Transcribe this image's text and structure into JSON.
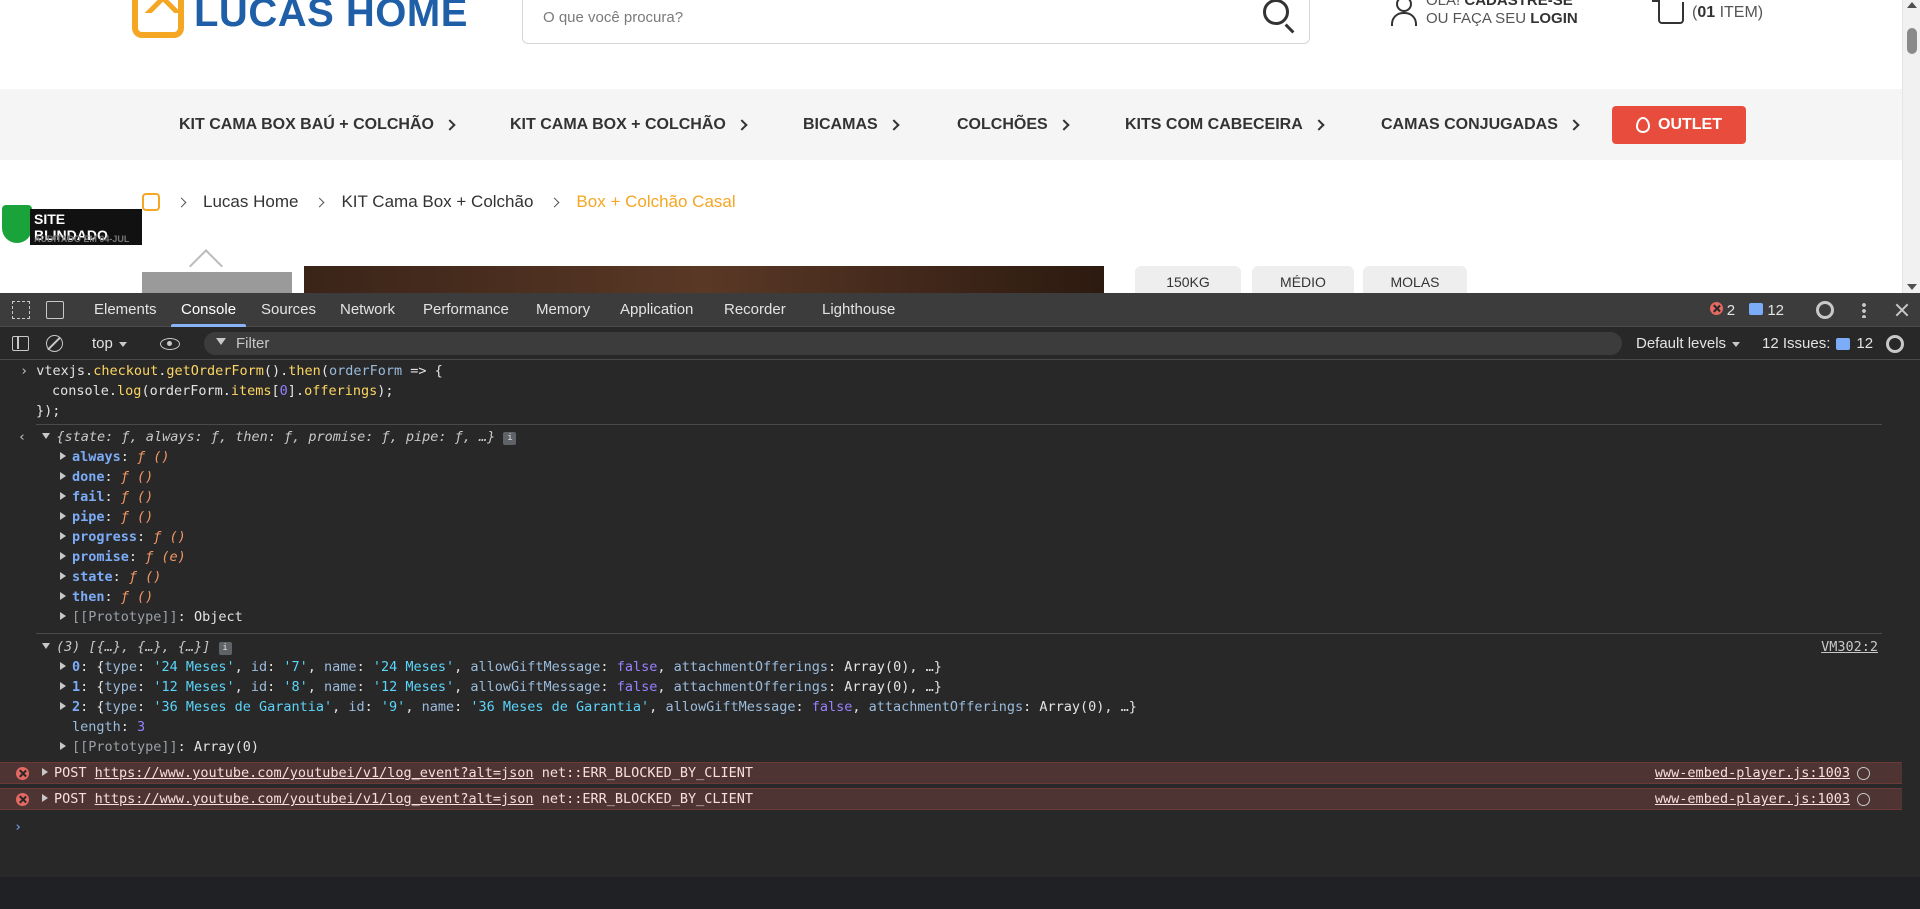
{
  "site": {
    "logo_text": "LUCAS HOME",
    "search_placeholder": "O que você procura?",
    "account_line1_prefix": "OLÁ!",
    "account_line1_bold": "CADASTRE-SE",
    "account_line2_prefix": "OU FAÇA SEU",
    "account_line2_bold": "LOGIN",
    "cart_count": "01",
    "cart_suffix": "ITEM)",
    "cart_prefix": "(",
    "menu": [
      {
        "label": "KIT CAMA BOX BAÚ + COLCHÃO"
      },
      {
        "label": "KIT CAMA BOX + COLCHÃO"
      },
      {
        "label": "BICAMAS"
      },
      {
        "label": "COLCHÕES"
      },
      {
        "label": "KITS COM CABECEIRA"
      },
      {
        "label": "CAMAS CONJUGADAS"
      }
    ],
    "outlet_label": "OUTLET",
    "badge_title": "SITE BLINDADO",
    "badge_sub": "AUDITADO EM 04-JUL",
    "breadcrumb": [
      "Lucas Home",
      "KIT Cama Box + Colchão",
      "Box + Colchão Casal"
    ],
    "chips": [
      "150KG",
      "MÉDIO",
      "MOLAS"
    ],
    "colors": {
      "brand_blue": "#1f5fa8",
      "brand_orange": "#f5a623",
      "outlet_red": "#e74c3c"
    }
  },
  "devtools": {
    "tabs": [
      "Elements",
      "Console",
      "Sources",
      "Network",
      "Performance",
      "Memory",
      "Application",
      "Recorder",
      "Lighthouse"
    ],
    "active_tab": "Console",
    "error_count": "2",
    "message_count": "12",
    "context": "top",
    "filter_placeholder": "Filter",
    "levels": "Default levels",
    "issues_label": "12 Issues:",
    "issues_count": "12"
  },
  "console": {
    "input_line1_obj": "vtexjs",
    "input_line1_a": ".",
    "input_line1_checkout": "checkout",
    "input_line1_get": "getOrderForm",
    "input_line1_then": "then",
    "input_line1_param": "orderForm",
    "input_line2_console": "console",
    "input_line2_log": "log",
    "input_line2_param": "orderForm",
    "input_line2_items": "items",
    "input_line2_idx": "0",
    "input_line2_offerings": "offerings",
    "input_line3": "});",
    "result_summary": "{state: ƒ, always: ƒ, then: ƒ, promise: ƒ, pipe: ƒ, …}",
    "result_props": [
      {
        "key": "always",
        "val": "ƒ ()"
      },
      {
        "key": "done",
        "val": "ƒ ()"
      },
      {
        "key": "fail",
        "val": "ƒ ()"
      },
      {
        "key": "pipe",
        "val": "ƒ ()"
      },
      {
        "key": "progress",
        "val": "ƒ ()"
      },
      {
        "key": "promise",
        "val": "ƒ (e)"
      },
      {
        "key": "state",
        "val": "ƒ ()"
      },
      {
        "key": "then",
        "val": "ƒ ()"
      }
    ],
    "result_proto": "[[Prototype]]",
    "result_proto_val": "Object",
    "array_summary": "(3) [{…}, {…}, {…}]",
    "array_source": "VM302:2",
    "array_items": [
      {
        "idx": "0",
        "type": "'24 Meses'",
        "id": "'7'",
        "name": "'24 Meses'"
      },
      {
        "idx": "1",
        "type": "'12 Meses'",
        "id": "'8'",
        "name": "'12 Meses'"
      },
      {
        "idx": "2",
        "type": "'36 Meses de Garantia'",
        "id": "'9'",
        "name": "'36 Meses de Garantia'"
      }
    ],
    "allow_gift": "false",
    "attachment_offerings": "Array(0)",
    "array_length_key": "length",
    "array_length": "3",
    "array_proto_val": "Array(0)",
    "errors": [
      {
        "method": "POST",
        "url": "https://www.youtube.com/youtubei/v1/log_event?alt=json",
        "msg": "net::ERR_BLOCKED_BY_CLIENT",
        "source": "www-embed-player.js:1003"
      },
      {
        "method": "POST",
        "url": "https://www.youtube.com/youtubei/v1/log_event?alt=json",
        "msg": "net::ERR_BLOCKED_BY_CLIENT",
        "source": "www-embed-player.js:1003"
      }
    ]
  }
}
